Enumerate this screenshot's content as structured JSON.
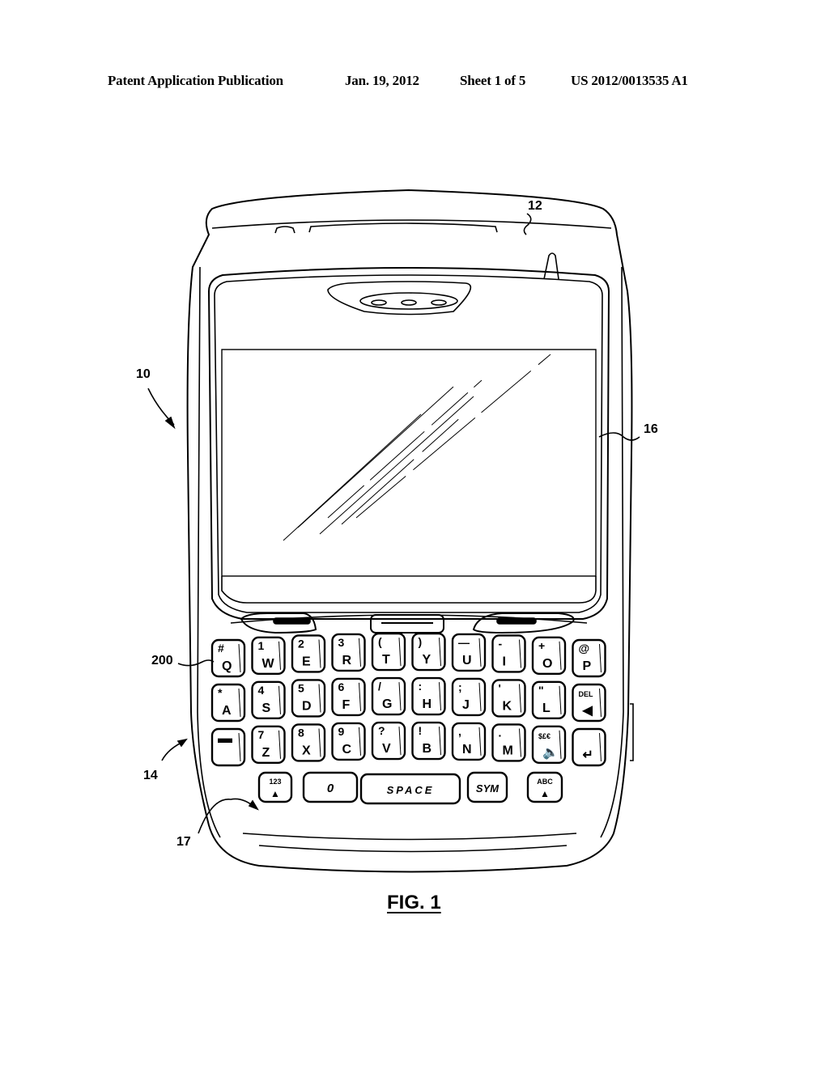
{
  "header": {
    "publication": "Patent Application Publication",
    "date": "Jan. 19, 2012",
    "sheet": "Sheet 1 of 5",
    "number": "US 2012/0013535 A1"
  },
  "figure": {
    "caption": "FIG. 1",
    "reference_numerals": {
      "device": "10",
      "housing_top": "12",
      "keyboard_area": "14",
      "display": "16",
      "bottom_surface": "17",
      "key": "200"
    }
  },
  "keyboard": {
    "rows": [
      [
        {
          "main": "Q",
          "alt": "#"
        },
        {
          "main": "W",
          "alt": "1"
        },
        {
          "main": "E",
          "alt": "2"
        },
        {
          "main": "R",
          "alt": "3"
        },
        {
          "main": "T",
          "alt": "("
        },
        {
          "main": "Y",
          "alt": ")"
        },
        {
          "main": "U",
          "alt": "—"
        },
        {
          "main": "I",
          "alt": "-"
        },
        {
          "main": "O",
          "alt": "+"
        },
        {
          "main": "P",
          "alt": "@"
        }
      ],
      [
        {
          "main": "A",
          "alt": "*"
        },
        {
          "main": "S",
          "alt": "4"
        },
        {
          "main": "D",
          "alt": "5"
        },
        {
          "main": "F",
          "alt": "6"
        },
        {
          "main": "G",
          "alt": "/"
        },
        {
          "main": "H",
          "alt": ":"
        },
        {
          "main": "J",
          "alt": ";"
        },
        {
          "main": "K",
          "alt": "'"
        },
        {
          "main": "L",
          "alt": "\""
        },
        {
          "main": "◀",
          "alt": "DEL"
        }
      ],
      [
        {
          "main": "",
          "alt": "▬"
        },
        {
          "main": "Z",
          "alt": "7"
        },
        {
          "main": "X",
          "alt": "8"
        },
        {
          "main": "C",
          "alt": "9"
        },
        {
          "main": "V",
          "alt": "?"
        },
        {
          "main": "B",
          "alt": "!"
        },
        {
          "main": "N",
          "alt": ","
        },
        {
          "main": "M",
          "alt": "."
        },
        {
          "main": "🔈",
          "alt": "$£€"
        },
        {
          "main": "↵",
          "alt": ""
        }
      ]
    ],
    "bottom_row": [
      {
        "main": "▲",
        "alt": "123"
      },
      {
        "main": "0",
        "alt": ""
      },
      {
        "main": "SPACE",
        "alt": ""
      },
      {
        "main": "SYM",
        "alt": ""
      },
      {
        "main": "▲",
        "alt": "ABC"
      }
    ]
  }
}
